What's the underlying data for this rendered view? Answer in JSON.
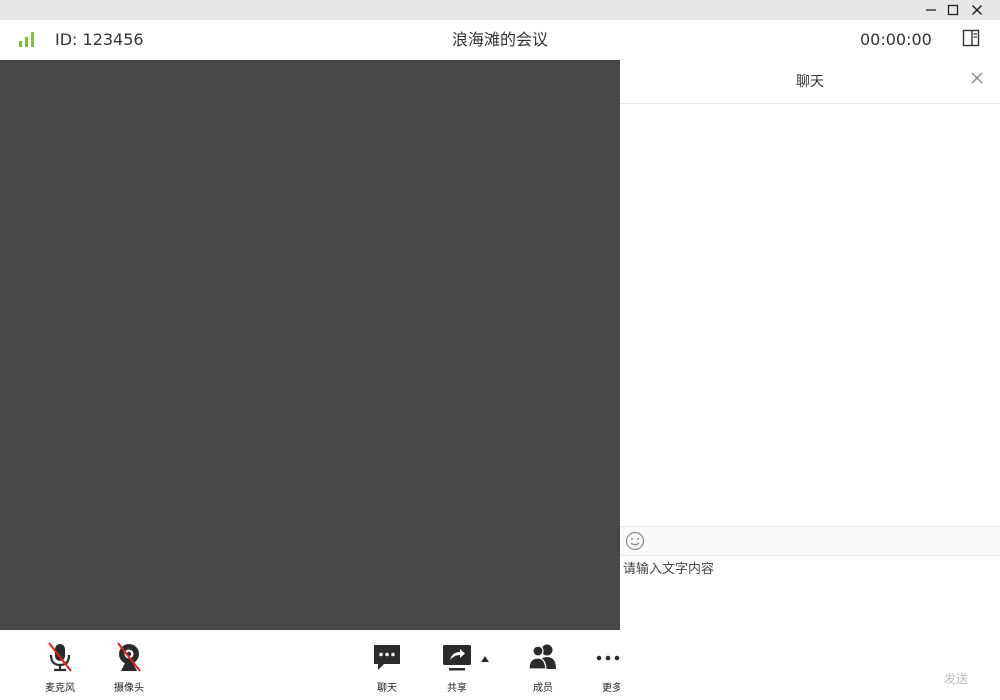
{
  "window_controls": {
    "minimize_icon": "minimize-icon",
    "maximize_icon": "maximize-icon",
    "close_icon": "close-icon"
  },
  "header": {
    "signal_icon": "signal-strength-icon",
    "meeting_id": "ID: 123456",
    "meeting_title": "浪海滩的会议",
    "timer": "00:00:00",
    "panel_toggle_icon": "sidebar-toggle-icon"
  },
  "toolbar": {
    "items": [
      {
        "label": "麦克风",
        "icon": "microphone-muted-icon"
      },
      {
        "label": "摄像头",
        "icon": "camera-off-icon"
      },
      {
        "label": "聊天",
        "icon": "chat-bubble-icon"
      },
      {
        "label": "共享",
        "icon": "share-screen-icon"
      },
      {
        "label": "成员",
        "icon": "members-icon"
      },
      {
        "label": "更多",
        "icon": "more-dots-icon"
      }
    ]
  },
  "chat": {
    "title": "聊天",
    "close_icon": "close-icon",
    "emoji_icon": "emoji-icon",
    "input_placeholder": "请输入文字内容",
    "input_value": "",
    "send_label": "发送"
  },
  "colors": {
    "signal_green": "#7ac142",
    "video_bg": "#474747",
    "titlebar_bg": "#e6e6e6",
    "muted_red": "#e02020"
  }
}
